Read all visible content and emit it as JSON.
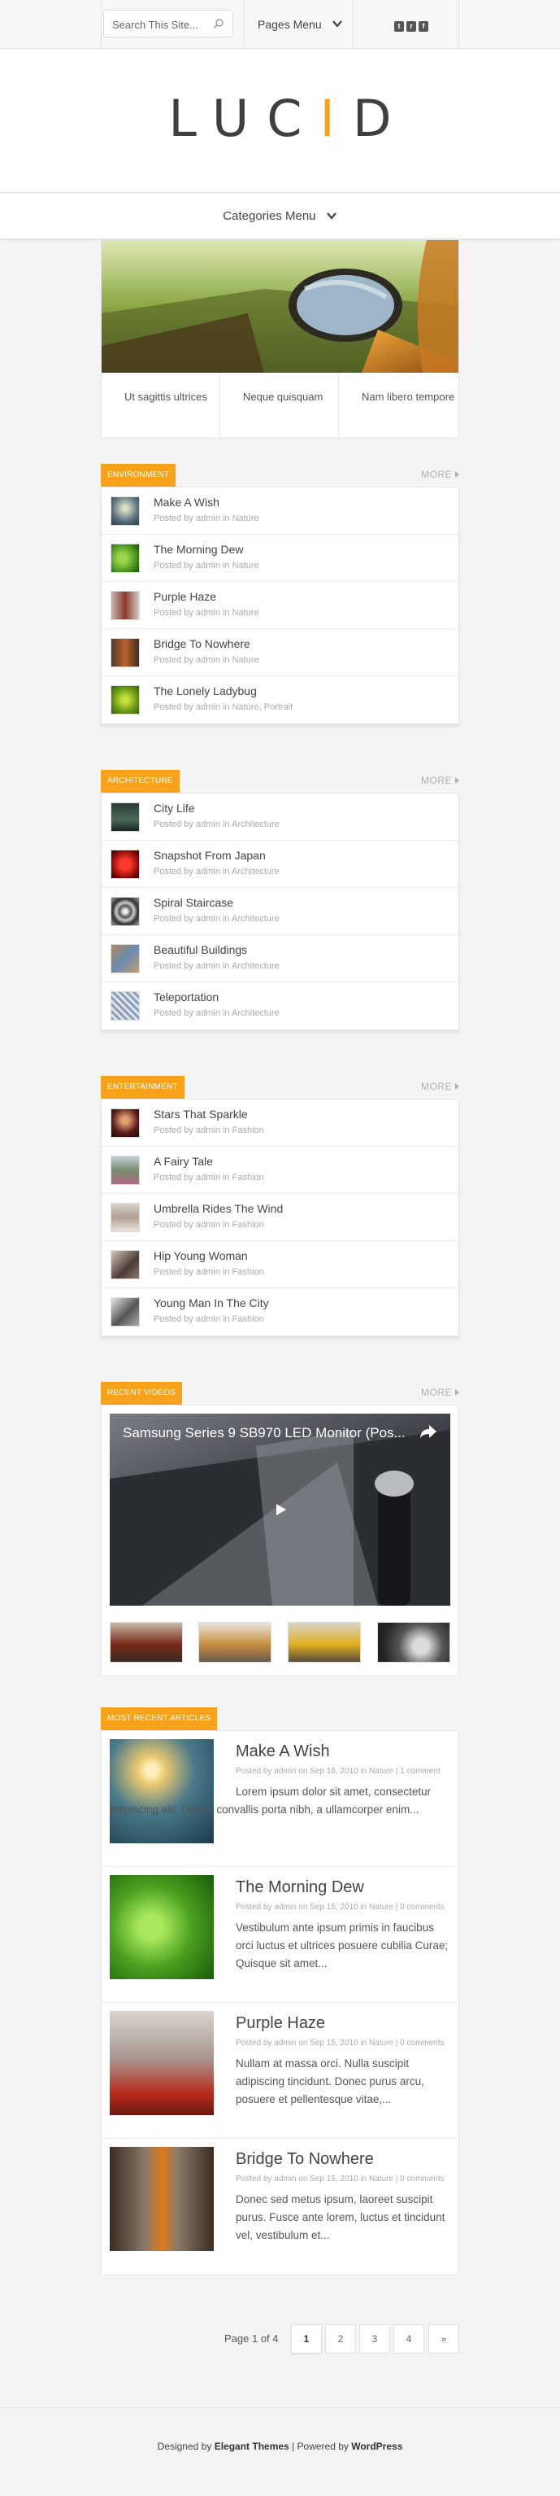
{
  "topbar": {
    "search_placeholder": "Search This Site...",
    "pages_menu_label": "Pages Menu",
    "social": [
      "twitter-icon",
      "rss-icon",
      "facebook-icon"
    ]
  },
  "logo": {
    "part1": "LUC",
    "accent_letter": "I",
    "part2": "D",
    "accent_color": "#f8a21c"
  },
  "categories_menu_label": "Categories Menu",
  "featured": {
    "tabs": [
      "Ut sagittis ultrices",
      "Neque quisquam",
      "Nam libero tempore"
    ]
  },
  "sections": [
    {
      "label": "Environment",
      "more": "MORE",
      "items": [
        {
          "title": "Make A Wish",
          "meta": "Posted by admin in Nature"
        },
        {
          "title": "The Morning Dew",
          "meta": "Posted by admin in Nature"
        },
        {
          "title": "Purple Haze",
          "meta": "Posted by admin in Nature"
        },
        {
          "title": "Bridge To Nowhere",
          "meta": "Posted by admin in Nature"
        },
        {
          "title": "The Lonely Ladybug",
          "meta": "Posted by admin in Nature, Portrait"
        }
      ]
    },
    {
      "label": "Architecture",
      "more": "MORE",
      "items": [
        {
          "title": "City Life",
          "meta": "Posted by admin in Architecture"
        },
        {
          "title": "Snapshot From Japan",
          "meta": "Posted by admin in Architecture"
        },
        {
          "title": "Spiral Staircase",
          "meta": "Posted by admin in Architecture"
        },
        {
          "title": "Beautiful Buildings",
          "meta": "Posted by admin in Architecture"
        },
        {
          "title": "Teleportation",
          "meta": "Posted by admin in Architecture"
        }
      ]
    },
    {
      "label": "Entertainment",
      "more": "MORE",
      "items": [
        {
          "title": "Stars That Sparkle",
          "meta": "Posted by admin in Fashion"
        },
        {
          "title": "A Fairy Tale",
          "meta": "Posted by admin in Fashion"
        },
        {
          "title": "Umbrella Rides The Wind",
          "meta": "Posted by admin in Fashion"
        },
        {
          "title": "Hip Young Woman",
          "meta": "Posted by admin in Fashion"
        },
        {
          "title": "Young Man In The City",
          "meta": "Posted by admin in Fashion"
        }
      ]
    }
  ],
  "videos": {
    "label": "Recent Videos",
    "more": "MORE",
    "main_title": "Samsung Series 9 SB970 LED Monitor (Pos..."
  },
  "recent_articles": {
    "label": "Most Recent Articles",
    "items": [
      {
        "title": "Make A Wish",
        "meta": "Posted by admin on Sep 16, 2010 in Nature | 1 comment",
        "excerpt": "Lorem ipsum dolor sit amet, consectetur adipiscing elit. Donec convallis porta nibh, a ullamcorper enim..."
      },
      {
        "title": "The Morning Dew",
        "meta": "Posted by admin on Sep 15, 2010 in Nature | 0 comments",
        "excerpt": "Vestibulum ante ipsum primis in faucibus orci luctus et ultrices posuere cubilia Curae; Quisque sit amet..."
      },
      {
        "title": "Purple Haze",
        "meta": "Posted by admin on Sep 15, 2010 in Nature | 0 comments",
        "excerpt": "Nullam at massa orci. Nulla suscipit adipiscing tincidunt. Donec purus arcu, posuere et pellentesque vitae,..."
      },
      {
        "title": "Bridge To Nowhere",
        "meta": "Posted by admin on Sep 15, 2010 in Nature | 0 comments",
        "excerpt": "Donec sed metus ipsum, laoreet suscipit purus. Fusce ante lorem, luctus et tincidunt vel, vestibulum et..."
      }
    ]
  },
  "pagination": {
    "info": "Page 1 of 4",
    "pages": [
      "1",
      "2",
      "3",
      "4",
      "»"
    ],
    "current": "1"
  },
  "footer": {
    "prefix": "Designed by",
    "designer": "Elegant Themes",
    "separator": "| Powered by",
    "platform": "WordPress"
  }
}
